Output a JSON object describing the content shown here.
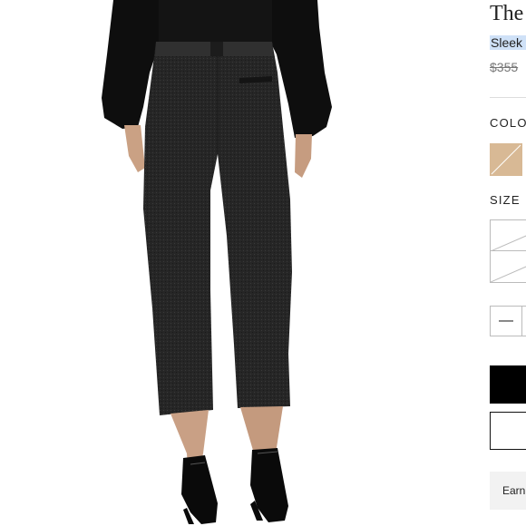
{
  "product": {
    "brand": "The",
    "name": "Sleek F",
    "price": "$355"
  },
  "options": {
    "color_label": "COLO",
    "color_swatch": "#d8b995",
    "size_label": "SIZE"
  },
  "quantity": {
    "minus_label": "—"
  },
  "actions": {
    "earn_label": "Earn"
  },
  "image": {
    "subject": "model in black blouse and cropped dark trousers with black strappy heels",
    "colors": {
      "blouse": "#0d0d0d",
      "trousers": "#262626",
      "skin": "#caa184",
      "shoes": "#0a0a0a"
    }
  }
}
